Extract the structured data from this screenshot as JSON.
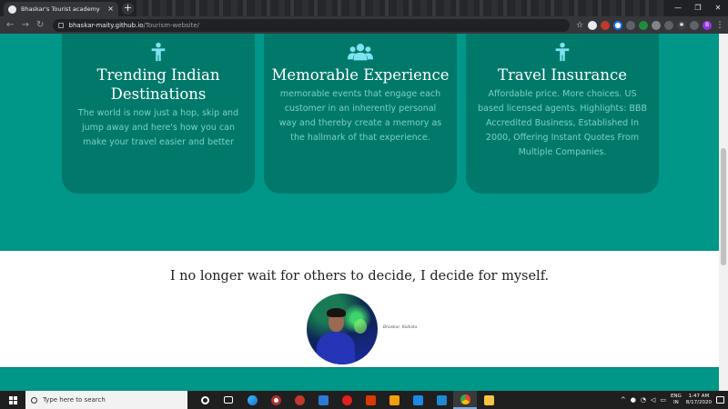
{
  "browser": {
    "tab_title": "Bhaskar's Tourist academy",
    "tab_close": "×",
    "new_tab": "+",
    "url_domain": "bhaskar-maity.github.io",
    "url_path": "/Tourism-website/",
    "profile_initial": "B",
    "win_minimize": "—",
    "win_maximize": "❐",
    "win_close": "✕",
    "back": "←",
    "forward": "→",
    "reload": "↻",
    "star": "☆",
    "menu": "⋮"
  },
  "features": {
    "cards": [
      {
        "icon": "person-icon",
        "title": "Trending Indian Destinations",
        "text": "The world is now just a hop, skip and jump away and here's how you can make your travel easier and better"
      },
      {
        "icon": "group-icon",
        "title": "Memorable Experience",
        "text": "memorable events that engage each customer in an inherently personal way and thereby create a memory as the hallmark of that experience."
      },
      {
        "icon": "person-icon",
        "title": "Travel Insurance",
        "text": "Affordable price. More choices. US based licensed agents. Highlights: BBB Accredited Business, Established In 2000, Offering Instant Quotes From Multiple Companies."
      }
    ]
  },
  "testimonial": {
    "quote": "I no longer wait for others to decide, I decide for myself.",
    "caption": "Bhaskar, Kolkata"
  },
  "taskbar": {
    "search_placeholder": "Type here to search",
    "lang_line1": "ENG",
    "lang_line2": "IN",
    "time": "1:47 AM",
    "date": "8/17/2020",
    "tray_chevron": "^"
  },
  "colors": {
    "section_bg": "#009688",
    "card_bg": "#00796b",
    "card_text": "#7ccfc4",
    "icon": "#7fe3ef"
  }
}
